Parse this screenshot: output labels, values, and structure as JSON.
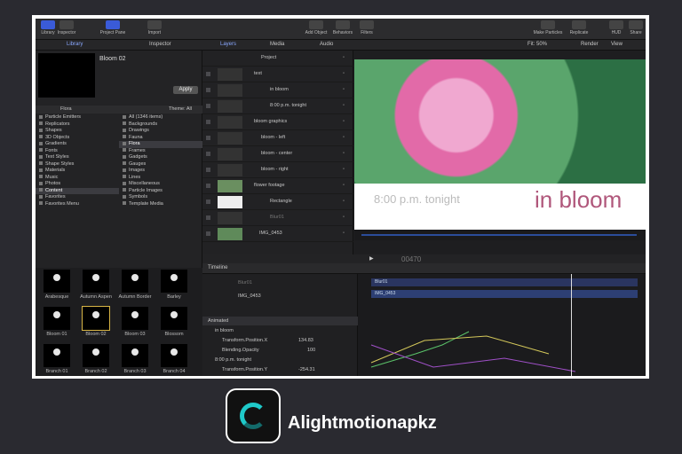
{
  "toolbar": {
    "left": [
      "Library",
      "Inspector",
      "Project Pane",
      "Import"
    ],
    "right": [
      "Add Object",
      "Behaviors",
      "Filters",
      "Make Particles",
      "Replicate",
      "HUD",
      "Share"
    ]
  },
  "panel_tabs": [
    "Library",
    "Inspector"
  ],
  "layer_tabs": [
    "Layers",
    "Media",
    "Audio"
  ],
  "viewer": {
    "fit": "Fit: 50%",
    "render": "Render",
    "view": "View"
  },
  "library": {
    "preview_title": "Bloom 02",
    "apply_label": "Apply",
    "folder": "Flora",
    "theme": "Theme: All",
    "categories": [
      "Particle Emitters",
      "Replicators",
      "Shapes",
      "3D Objects",
      "Gradients",
      "Fonts",
      "Text Styles",
      "Shape Styles",
      "Materials",
      "Music",
      "Photos",
      "Content",
      "Favorites",
      "Favorites Menu"
    ],
    "subcategories": [
      "All (1346 items)",
      "Backgrounds",
      "Drawings",
      "Fauna",
      "Flora",
      "Frames",
      "Gadgets",
      "Gauges",
      "Images",
      "Lines",
      "Miscellaneous",
      "Particle Images",
      "Symbols",
      "Template Media"
    ],
    "items": [
      "Arabesque",
      "Autumn Aspen",
      "Autumn Border",
      "Barley",
      "Bloom 01",
      "Bloom 02",
      "Bloom 03",
      "Blossom",
      "Branch 01",
      "Branch 02",
      "Branch 03",
      "Branch 04"
    ]
  },
  "layers": [
    {
      "name": "Project"
    },
    {
      "name": "text"
    },
    {
      "name": "in bloom"
    },
    {
      "name": "8:00 p.m. tonight"
    },
    {
      "name": "bloom graphics"
    },
    {
      "name": "bloom - left"
    },
    {
      "name": "bloom - center"
    },
    {
      "name": "bloom - right"
    },
    {
      "name": "flower footage"
    },
    {
      "name": "Rectangle"
    },
    {
      "name": "Blur01"
    },
    {
      "name": "IMG_0453"
    }
  ],
  "canvas": {
    "subtitle": "8:00 p.m. tonight",
    "title": "in bloom"
  },
  "transport": {
    "timecode": "00470"
  },
  "timeline": {
    "label": "Timeline",
    "tracks": [
      "Blur01",
      "IMG_0453"
    ],
    "animated": "Animated",
    "params": [
      {
        "name": "in bloom",
        "value": ""
      },
      {
        "name": "Transform.Position.X",
        "value": "134.83"
      },
      {
        "name": "Blending.Opacity",
        "value": "100"
      },
      {
        "name": "8:00 p.m. tonight",
        "value": ""
      },
      {
        "name": "Transform.Position.Y",
        "value": "-254.31"
      }
    ]
  },
  "footer": {
    "brand": "Alightmotionapkz"
  }
}
